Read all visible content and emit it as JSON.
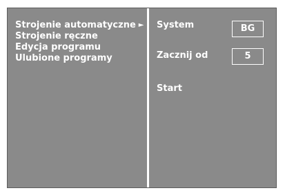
{
  "menu": {
    "items": [
      {
        "label": "Strojenie automatyczne",
        "selected": true
      },
      {
        "label": "Strojenie ręczne"
      },
      {
        "label": "Edycja programu"
      },
      {
        "label": "Ulubione programy"
      }
    ],
    "selected_arrow": "►"
  },
  "settings": {
    "system_label": "System",
    "system_value": "BG",
    "start_from_label": "Zacznij od",
    "start_from_value": "5",
    "start_label": "Start"
  },
  "colors": {
    "background": "#8a8a8a",
    "text": "#ffffff",
    "divider": "#ffffff"
  }
}
